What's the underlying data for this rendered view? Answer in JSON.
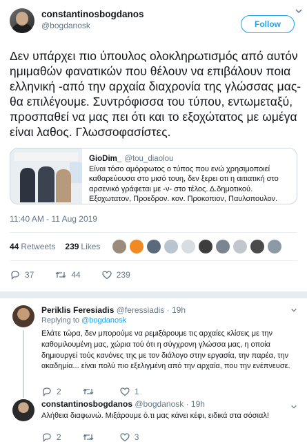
{
  "main_tweet": {
    "display_name": "constantinosbogdanos",
    "handle": "@bogdanosk",
    "follow_label": "Follow",
    "text": "Δεν υπάρχει πιο ύπουλος ολοκληρωτισμός από αυτόν  ημιμαθών φανατικών που θέλουν να επιβάλουν ποια ελληνική -από την αρχαία διαχρονία της γλώσσας μας- θα επιλέγουμε. Συντρόφισσα του τύπου, εντωμεταξύ, προσπαθεί να μας πει ότι και το εξοχώτατος με ωμέγα είναι λαθος. Γλωσσοφασίστες.",
    "quoted": {
      "name": "GioDim_",
      "handle": "@tou_diaolou",
      "text": "Είναι τόσο αμόρφωτος ο τύπος που ενώ χρησιμοποιεί καθαρεύουσα στο μισό τουη, δεν ξερει οτι η αιτιατική στο αρσενικό γράφεται με -ν- στο τέλος. Δ.δημοτικού. Εξοχωτατον, Προεδρον. κον. Προκοπιον, Παυλοπουλον. @bogdanosk"
    },
    "timestamp": "11:40 AM - 11 Aug 2019",
    "retweets_count": "44",
    "retweets_label": "Retweets",
    "likes_count": "239",
    "likes_label": "Likes",
    "liker_colors": [
      "#9b8b7a",
      "#f08a24",
      "#5a6a7a",
      "#b8c4cf",
      "#d8dde2",
      "#3d3d3d",
      "#7a8590",
      "#c1c7cc",
      "#4a4a4a",
      "#8c9aa6"
    ],
    "actions": {
      "reply_count": "37",
      "retweet_count": "44",
      "like_count": "239"
    }
  },
  "replies": [
    {
      "display_name": "Periklis Feresiadis",
      "handle": "@feressiadis",
      "time": "· 19h",
      "reply_to_prefix": "Replying to ",
      "reply_to_handle": "@bogdanosk",
      "text": "Ελάτε τώρα, δεν μπορούμε να ρεμιξάρουμε τις αρχαίες κλίσεις με την καθομιλουμένη μας, χώρια τού ότι η σύγχρονη γλώσσα μας, η οποία δημιουργεί τούς κανόνες της με τον διάλογο στην εργασία, την παρέα, την ακαδημία...  είναι πολύ πιο εξελιγμένη από την αρχαία, που την ενέπνευσε.",
      "reply_count": "2",
      "retweet_count": "",
      "like_count": "1"
    },
    {
      "display_name": "constantinosbogdanos",
      "handle": "@bogdanosk",
      "time": "· 19h",
      "text": "Αλήθεια διαφωνώ. Μιξάρουμε ό.τι μας κάνει κέφι, ειδικά στα σόσιαλ!",
      "reply_count": "2",
      "retweet_count": "",
      "like_count": "3"
    }
  ]
}
